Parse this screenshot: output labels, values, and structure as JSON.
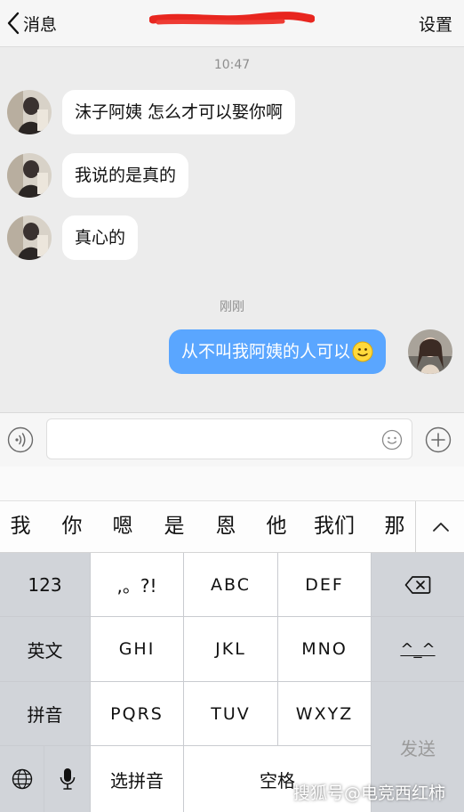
{
  "nav": {
    "back_label": "消息",
    "settings_label": "设置"
  },
  "chat": {
    "timestamps": [
      "10:47",
      "刚刚"
    ],
    "messages": [
      {
        "from": "other",
        "text": "沫子阿姨 怎么才可以娶你啊"
      },
      {
        "from": "other",
        "text": "我说的是真的"
      },
      {
        "from": "other",
        "text": "真心的"
      },
      {
        "from": "me",
        "text": "从不叫我阿姨的人可以"
      }
    ],
    "colors": {
      "my_bubble": "#5aa6ff",
      "other_bubble": "#ffffff"
    }
  },
  "input": {
    "value": "",
    "icons": [
      "voice-icon",
      "emoji-icon",
      "plus-icon"
    ]
  },
  "candidates": [
    "我",
    "你",
    "嗯",
    "是",
    "恩",
    "他",
    "我们",
    "那"
  ],
  "keyboard": {
    "row1": [
      "123",
      ",。?!",
      "ABC",
      "DEF"
    ],
    "row2": [
      "英文",
      "GHI",
      "JKL",
      "MNO"
    ],
    "row3": [
      "拼音",
      "PQRS",
      "TUV",
      "WXYZ"
    ],
    "row4": [
      "选拼音",
      "空格"
    ],
    "send": "发送",
    "face_key": "^_^"
  },
  "watermark": "搜狐号@电竞西红柿"
}
